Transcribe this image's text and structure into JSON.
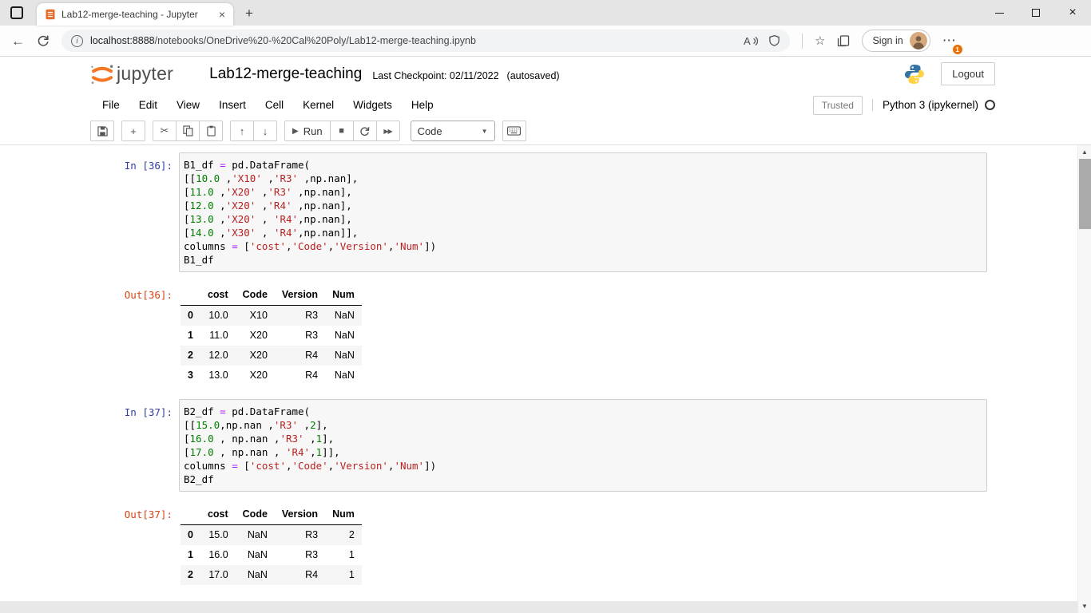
{
  "colors": {
    "jupyter_orange": "#F37726",
    "prompt_in": "#303F9F",
    "prompt_out": "#D84315",
    "code_number": "#008000",
    "code_string": "#BA2121",
    "code_operator": "#AA22FF",
    "notification_orange": "#e8710a"
  },
  "icons": {
    "back": "←",
    "new_tab": "+",
    "close": "×",
    "tab_close": "×",
    "more": "⋯",
    "star": "☆",
    "info": "i",
    "add_cell": "+",
    "cut": "✂",
    "move_up": "↑",
    "move_down": "↓",
    "run_play": "▶",
    "stop": "■",
    "fast_forward": "▶▶",
    "select_chevron": "▼",
    "scroll_up": "▲",
    "scroll_down": "▼"
  },
  "browser": {
    "tab_title": "Lab12-merge-teaching - Jupyter",
    "url_host": "localhost:8888",
    "url_path": "/notebooks/OneDrive%20-%20Cal%20Poly/Lab12-merge-teaching.ipynb",
    "signin_label": "Sign in",
    "notification_count": "1"
  },
  "header": {
    "logo_text": "jupyter",
    "notebook_title": "Lab12-merge-teaching",
    "checkpoint_text": "Last Checkpoint: 02/11/2022",
    "autosave_text": "(autosaved)",
    "logout_label": "Logout"
  },
  "menu": {
    "items": [
      "File",
      "Edit",
      "View",
      "Insert",
      "Cell",
      "Kernel",
      "Widgets",
      "Help"
    ],
    "trusted_label": "Trusted",
    "kernel_name": "Python 3 (ipykernel)"
  },
  "toolbar": {
    "run_label": "Run",
    "cell_type_value": "Code"
  },
  "cells": [
    {
      "input_prompt": "In [36]:",
      "code": [
        [
          {
            "t": "B1_df ",
            "k": "p"
          },
          {
            "t": "=",
            "k": "o"
          },
          {
            "t": " pd.DataFrame(",
            "k": "p"
          }
        ],
        [
          {
            "t": "[[",
            "k": "p"
          },
          {
            "t": "10.0",
            "k": "n"
          },
          {
            "t": " ,",
            "k": "p"
          },
          {
            "t": "'X10'",
            "k": "s"
          },
          {
            "t": " ,",
            "k": "p"
          },
          {
            "t": "'R3'",
            "k": "s"
          },
          {
            "t": " ,np.nan],",
            "k": "p"
          }
        ],
        [
          {
            "t": "[",
            "k": "p"
          },
          {
            "t": "11.0",
            "k": "n"
          },
          {
            "t": " ,",
            "k": "p"
          },
          {
            "t": "'X20'",
            "k": "s"
          },
          {
            "t": " ,",
            "k": "p"
          },
          {
            "t": "'R3'",
            "k": "s"
          },
          {
            "t": " ,np.nan],",
            "k": "p"
          }
        ],
        [
          {
            "t": "[",
            "k": "p"
          },
          {
            "t": "12.0",
            "k": "n"
          },
          {
            "t": " ,",
            "k": "p"
          },
          {
            "t": "'X20'",
            "k": "s"
          },
          {
            "t": " ,",
            "k": "p"
          },
          {
            "t": "'R4'",
            "k": "s"
          },
          {
            "t": " ,np.nan],",
            "k": "p"
          }
        ],
        [
          {
            "t": "[",
            "k": "p"
          },
          {
            "t": "13.0",
            "k": "n"
          },
          {
            "t": " ,",
            "k": "p"
          },
          {
            "t": "'X20'",
            "k": "s"
          },
          {
            "t": " , ",
            "k": "p"
          },
          {
            "t": "'R4'",
            "k": "s"
          },
          {
            "t": ",np.nan],",
            "k": "p"
          }
        ],
        [
          {
            "t": "[",
            "k": "p"
          },
          {
            "t": "14.0",
            "k": "n"
          },
          {
            "t": " ,",
            "k": "p"
          },
          {
            "t": "'X30'",
            "k": "s"
          },
          {
            "t": " , ",
            "k": "p"
          },
          {
            "t": "'R4'",
            "k": "s"
          },
          {
            "t": ",np.nan]],",
            "k": "p"
          }
        ],
        [
          {
            "t": "columns ",
            "k": "p"
          },
          {
            "t": "=",
            "k": "o"
          },
          {
            "t": " [",
            "k": "p"
          },
          {
            "t": "'cost'",
            "k": "s"
          },
          {
            "t": ",",
            "k": "p"
          },
          {
            "t": "'Code'",
            "k": "s"
          },
          {
            "t": ",",
            "k": "p"
          },
          {
            "t": "'Version'",
            "k": "s"
          },
          {
            "t": ",",
            "k": "p"
          },
          {
            "t": "'Num'",
            "k": "s"
          },
          {
            "t": "])",
            "k": "p"
          }
        ],
        [
          {
            "t": "B1_df",
            "k": "p"
          }
        ]
      ],
      "output_prompt": "Out[36]:",
      "output_table": {
        "columns": [
          "cost",
          "Code",
          "Version",
          "Num"
        ],
        "index": [
          "0",
          "1",
          "2",
          "3"
        ],
        "rows": [
          [
            "10.0",
            "X10",
            "R3",
            "NaN"
          ],
          [
            "11.0",
            "X20",
            "R3",
            "NaN"
          ],
          [
            "12.0",
            "X20",
            "R4",
            "NaN"
          ],
          [
            "13.0",
            "X20",
            "R4",
            "NaN"
          ]
        ]
      }
    },
    {
      "input_prompt": "In [37]:",
      "code": [
        [
          {
            "t": "B2_df ",
            "k": "p"
          },
          {
            "t": "=",
            "k": "o"
          },
          {
            "t": " pd.DataFrame(",
            "k": "p"
          }
        ],
        [
          {
            "t": "[[",
            "k": "p"
          },
          {
            "t": "15.0",
            "k": "n"
          },
          {
            "t": ",np.nan ,",
            "k": "p"
          },
          {
            "t": "'R3'",
            "k": "s"
          },
          {
            "t": " ,",
            "k": "p"
          },
          {
            "t": "2",
            "k": "n"
          },
          {
            "t": "],",
            "k": "p"
          }
        ],
        [
          {
            "t": "[",
            "k": "p"
          },
          {
            "t": "16.0",
            "k": "n"
          },
          {
            "t": " , np.nan ,",
            "k": "p"
          },
          {
            "t": "'R3'",
            "k": "s"
          },
          {
            "t": " ,",
            "k": "p"
          },
          {
            "t": "1",
            "k": "n"
          },
          {
            "t": "],",
            "k": "p"
          }
        ],
        [
          {
            "t": "[",
            "k": "p"
          },
          {
            "t": "17.0",
            "k": "n"
          },
          {
            "t": " , np.nan , ",
            "k": "p"
          },
          {
            "t": "'R4'",
            "k": "s"
          },
          {
            "t": ",",
            "k": "p"
          },
          {
            "t": "1",
            "k": "n"
          },
          {
            "t": "]],",
            "k": "p"
          }
        ],
        [
          {
            "t": "columns ",
            "k": "p"
          },
          {
            "t": "=",
            "k": "o"
          },
          {
            "t": " [",
            "k": "p"
          },
          {
            "t": "'cost'",
            "k": "s"
          },
          {
            "t": ",",
            "k": "p"
          },
          {
            "t": "'Code'",
            "k": "s"
          },
          {
            "t": ",",
            "k": "p"
          },
          {
            "t": "'Version'",
            "k": "s"
          },
          {
            "t": ",",
            "k": "p"
          },
          {
            "t": "'Num'",
            "k": "s"
          },
          {
            "t": "])",
            "k": "p"
          }
        ],
        [
          {
            "t": "B2_df",
            "k": "p"
          }
        ]
      ],
      "output_prompt": "Out[37]:",
      "output_table": {
        "columns": [
          "cost",
          "Code",
          "Version",
          "Num"
        ],
        "index": [
          "0",
          "1",
          "2"
        ],
        "rows": [
          [
            "15.0",
            "NaN",
            "R3",
            "2"
          ],
          [
            "16.0",
            "NaN",
            "R3",
            "1"
          ],
          [
            "17.0",
            "NaN",
            "R4",
            "1"
          ]
        ]
      }
    }
  ]
}
